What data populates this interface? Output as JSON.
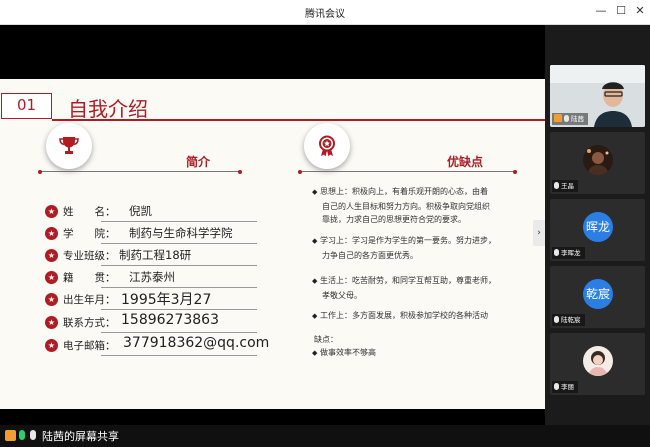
{
  "window": {
    "title": "腾讯会议"
  },
  "slide": {
    "section_number": "01",
    "section_title": "自我介绍",
    "intro_heading": "简介",
    "pros_heading": "优缺点",
    "info": [
      {
        "label": "姓　　名：",
        "value": "倪凯"
      },
      {
        "label": "学　　院：",
        "value": "制药与生命科学学院"
      },
      {
        "label": "专业班级：",
        "value": "制药工程18研"
      },
      {
        "label": "籍　　贯：",
        "value": "江苏泰州"
      },
      {
        "label": "出生年月：",
        "value": "1995年3月27"
      },
      {
        "label": "联系方式：",
        "value": "15896273863"
      },
      {
        "label": "电子邮箱：",
        "value": "377918362@qq.com"
      }
    ],
    "points": [
      {
        "text": "思想上：积极向上，有着乐观开朗的心态，由着",
        "cont": "自己的人生目标和努力方向。积极争取向党组织",
        "cont2": "靠拢，力求自己的思想更符合党的要求。"
      },
      {
        "text": "学习上：学习是作为学生的第一要务。努力进步，",
        "cont": "力争自己的各方面更优秀。"
      },
      {
        "text": "生活上：吃苦耐劳，和同学互帮互助，尊重老师，",
        "cont": "孝敬父母。"
      },
      {
        "text": "工作上：多方面发展，积极参加学校的各种活动"
      }
    ],
    "shortcoming_label": "缺点：",
    "shortcoming": "做事效率不够高"
  },
  "participants": [
    {
      "name": "陆茜",
      "type": "video"
    },
    {
      "name": "王晶",
      "type": "image"
    },
    {
      "name": "李晖龙",
      "type": "text",
      "avatar": "晖龙"
    },
    {
      "name": "陆乾宸",
      "type": "text",
      "avatar": "乾宸"
    },
    {
      "name": "李丽",
      "type": "image"
    }
  ],
  "bottom": {
    "status": "陆茜的屏幕共享"
  },
  "colors": {
    "accent": "#b01c24",
    "avatar_blue": "#2b7ee4"
  }
}
